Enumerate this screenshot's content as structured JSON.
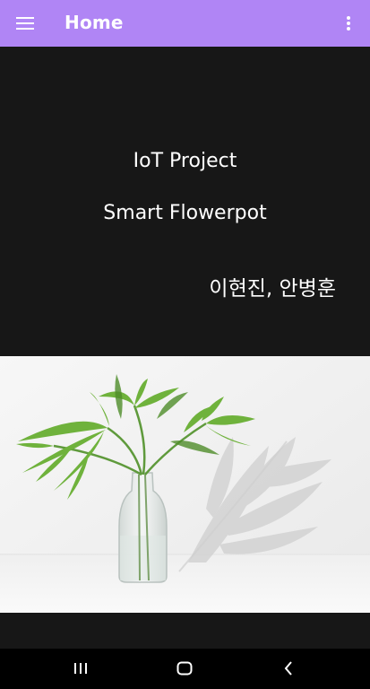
{
  "app_bar": {
    "title": "Home",
    "background_color": "#b085f5",
    "menu_icon": "hamburger-menu-icon",
    "overflow_icon": "more-vert-icon"
  },
  "content": {
    "line1": "IoT Project",
    "line2": "Smart Flowerpot",
    "line3": "이현진, 안병훈",
    "background_color": "#171717"
  },
  "hero_image": {
    "subject": "palm-leaves-in-glass-vase"
  },
  "nav_bar": {
    "recents_icon": "recents-icon",
    "home_icon": "home-icon",
    "back_icon": "back-icon"
  }
}
